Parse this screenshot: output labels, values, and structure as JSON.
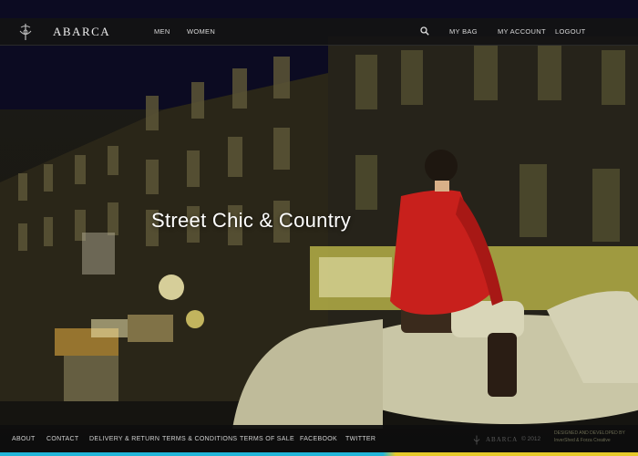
{
  "header": {
    "brand": "ABARCA",
    "nav_left": [
      "MEN",
      "WOMEN"
    ],
    "nav_right": {
      "bag": "MY BAG",
      "account": "MY ACCOUNT",
      "logout": "LOGOUT"
    }
  },
  "hero": {
    "headline": "Street Chic & Country"
  },
  "footer": {
    "links": [
      "ABOUT",
      "CONTACT",
      "DELIVERY & RETURN",
      "TERMS & CONDITIONS",
      "TERMS OF SALE",
      "FACEBOOK",
      "TWITTER"
    ],
    "brand": "ABARCA",
    "year": "© 2012",
    "credits_line1": "DESIGNED AND DEVELOPED BY",
    "credits_line2": "InverShed & Forza Creative"
  },
  "colors": {
    "accent_blue": "#21b6d9",
    "accent_yellow": "#e5c92a",
    "jacket_red": "#c8201c"
  }
}
